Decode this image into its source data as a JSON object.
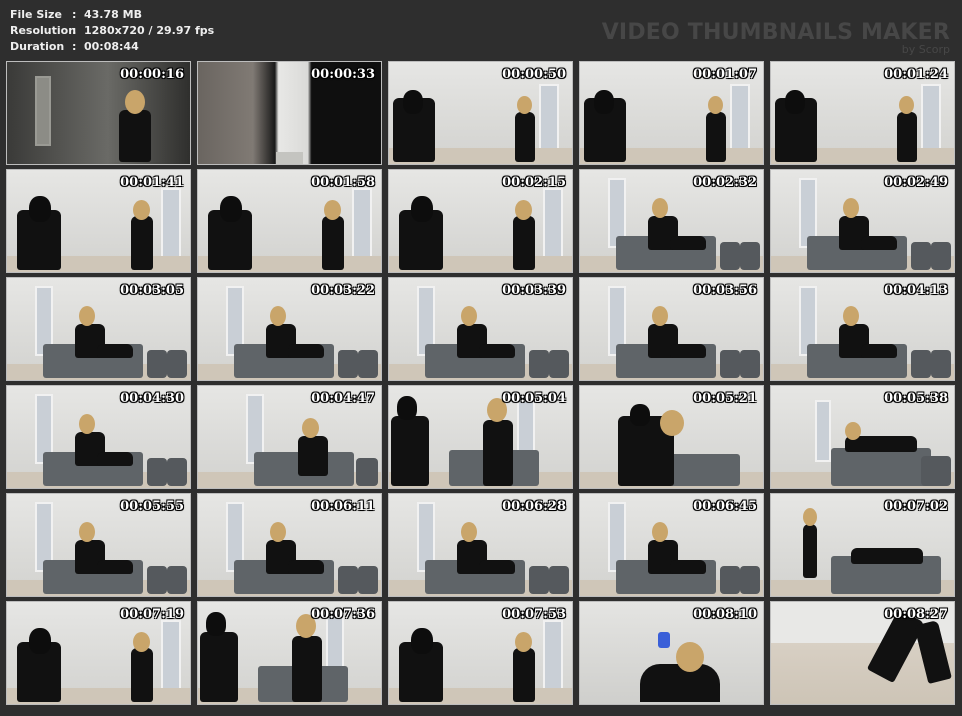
{
  "info": {
    "rows": [
      {
        "label": "File Size",
        "sep": ":",
        "value": "43.78 MB"
      },
      {
        "label": "Resolution",
        "sep": ":",
        "value": "1280x720 / 29.97 fps"
      },
      {
        "label": "Duration",
        "sep": ":",
        "value": "00:08:44"
      }
    ]
  },
  "watermark": {
    "title": "VIDEO THUMBNAILS MAKER",
    "by": "by Scorp"
  },
  "thumbnails": [
    {
      "time": "00:00:16",
      "scene": "hall"
    },
    {
      "time": "00:00:33",
      "scene": "doorway"
    },
    {
      "time": "00:00:50",
      "scene": "faceoff"
    },
    {
      "time": "00:01:07",
      "scene": "faceoff"
    },
    {
      "time": "00:01:24",
      "scene": "faceoff"
    },
    {
      "time": "00:01:41",
      "scene": "faceoff-close"
    },
    {
      "time": "00:01:58",
      "scene": "faceoff-close"
    },
    {
      "time": "00:02:15",
      "scene": "faceoff-close"
    },
    {
      "time": "00:02:32",
      "scene": "bed"
    },
    {
      "time": "00:02:49",
      "scene": "bed"
    },
    {
      "time": "00:03:05",
      "scene": "bed"
    },
    {
      "time": "00:03:22",
      "scene": "bed"
    },
    {
      "time": "00:03:39",
      "scene": "bed"
    },
    {
      "time": "00:03:56",
      "scene": "bed"
    },
    {
      "time": "00:04:13",
      "scene": "bed"
    },
    {
      "time": "00:04:30",
      "scene": "bed"
    },
    {
      "time": "00:04:47",
      "scene": "bed-phone"
    },
    {
      "time": "00:05:04",
      "scene": "sword"
    },
    {
      "time": "00:05:21",
      "scene": "struggle"
    },
    {
      "time": "00:05:38",
      "scene": "bed-lying"
    },
    {
      "time": "00:05:55",
      "scene": "bed"
    },
    {
      "time": "00:06:11",
      "scene": "bed"
    },
    {
      "time": "00:06:28",
      "scene": "bed"
    },
    {
      "time": "00:06:45",
      "scene": "bed"
    },
    {
      "time": "00:07:02",
      "scene": "standing-bed"
    },
    {
      "time": "00:07:19",
      "scene": "faceoff-close"
    },
    {
      "time": "00:07:36",
      "scene": "sword"
    },
    {
      "time": "00:07:53",
      "scene": "faceoff-close"
    },
    {
      "time": "00:08:10",
      "scene": "gun-closeup"
    },
    {
      "time": "00:08:27",
      "scene": "legs"
    }
  ]
}
